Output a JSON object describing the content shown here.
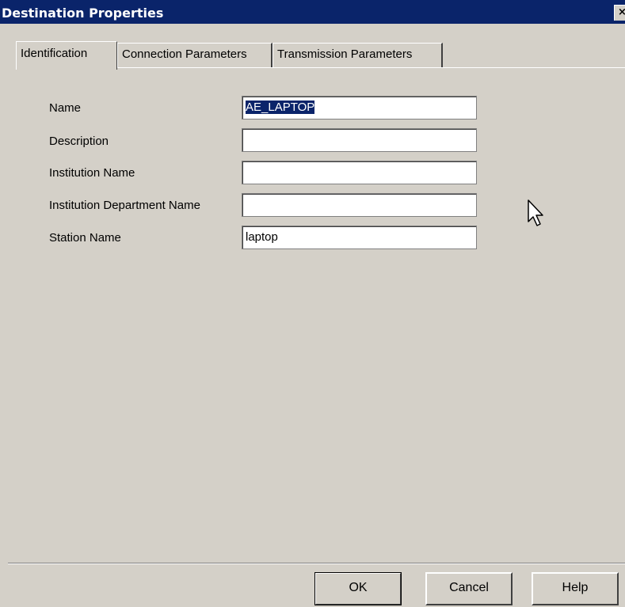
{
  "window": {
    "title": "Destination Properties",
    "close_glyph": "×"
  },
  "tabs": [
    {
      "label": "Identification",
      "active": true
    },
    {
      "label": "Connection Parameters",
      "active": false
    },
    {
      "label": "Transmission Parameters",
      "active": false
    }
  ],
  "form": {
    "name": {
      "label": "Name",
      "value": "AE_LAPTOP",
      "selected": true
    },
    "description": {
      "label": "Description",
      "value": ""
    },
    "institution_name": {
      "label": "Institution Name",
      "value": ""
    },
    "institution_department_name": {
      "label": "Institution Department Name",
      "value": ""
    },
    "station_name": {
      "label": "Station Name",
      "value": "laptop"
    }
  },
  "buttons": {
    "ok": "OK",
    "cancel": "Cancel",
    "help": "Help"
  },
  "colors": {
    "face": "#d4d0c8",
    "title_bar": "#0a246a",
    "selection": "#0a246a"
  },
  "icons": {
    "cursor": "arrow-pointer-icon"
  }
}
